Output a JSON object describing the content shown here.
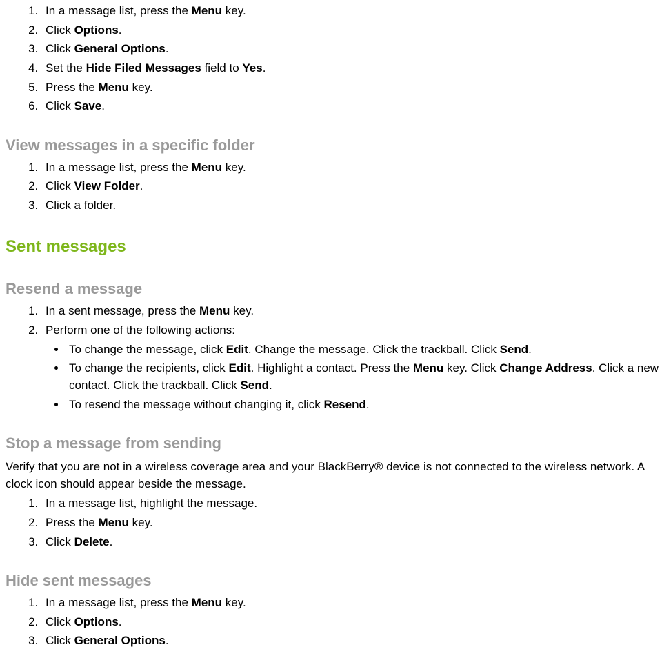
{
  "section1": {
    "steps": [
      {
        "pre": "In a message list, press the ",
        "bold": "Menu",
        "post": " key."
      },
      {
        "pre": "Click ",
        "bold": "Options",
        "post": "."
      },
      {
        "pre": "Click ",
        "bold": "General Options",
        "post": "."
      },
      {
        "multi": true
      },
      {
        "pre": "Press the ",
        "bold": "Menu",
        "post": " key."
      },
      {
        "pre": "Click ",
        "bold": "Save",
        "post": "."
      }
    ],
    "step4": {
      "p1": "Set the ",
      "b1": "Hide Filed Messages",
      "p2": " field to ",
      "b2": "Yes",
      "p3": "."
    }
  },
  "heading_view_folder": "View messages in a specific folder",
  "view_folder_steps": [
    {
      "pre": "In a message list, press the ",
      "bold": "Menu",
      "post": " key."
    },
    {
      "pre": "Click ",
      "bold": "View Folder",
      "post": "."
    },
    {
      "pre": "Click a folder.",
      "bold": "",
      "post": ""
    }
  ],
  "heading_sent": "Sent messages",
  "heading_resend": "Resend a message",
  "resend_steps": {
    "s1": {
      "pre": "In a sent message, press the ",
      "bold": "Menu",
      "post": " key."
    },
    "s2": {
      "text": "Perform one of the following actions:"
    },
    "b1": {
      "p1": "To change the message, click ",
      "bold1": "Edit",
      "p2": ". Change the message. Click the trackball. Click ",
      "bold2": "Send",
      "p3": "."
    },
    "b2": {
      "p1": "To change the recipients, click ",
      "bold1": "Edit",
      "p2": ". Highlight a contact. Press the ",
      "bold2": "Menu",
      "p3": " key. Click ",
      "bold3": "Change Address",
      "p4": ". Click a new contact. Click the trackball. Click ",
      "bold4": "Send",
      "p5": "."
    },
    "b3": {
      "p1": "To resend the message without changing it, click ",
      "bold1": "Resend",
      "p2": "."
    }
  },
  "heading_stop": "Stop a message from sending",
  "stop_intro": "Verify that you are not in a wireless coverage area and your BlackBerry® device is not connected to the wireless network. A clock icon should appear beside the message.",
  "stop_steps": [
    {
      "pre": "In a message list, highlight the message.",
      "bold": "",
      "post": ""
    },
    {
      "pre": "Press the ",
      "bold": "Menu",
      "post": " key."
    },
    {
      "pre": "Click ",
      "bold": "Delete",
      "post": "."
    }
  ],
  "heading_hide": "Hide sent messages",
  "hide_steps": [
    {
      "pre": "In a message list, press the ",
      "bold": "Menu",
      "post": " key."
    },
    {
      "pre": "Click ",
      "bold": "Options",
      "post": "."
    },
    {
      "pre": "Click ",
      "bold": "General Options",
      "post": "."
    }
  ]
}
